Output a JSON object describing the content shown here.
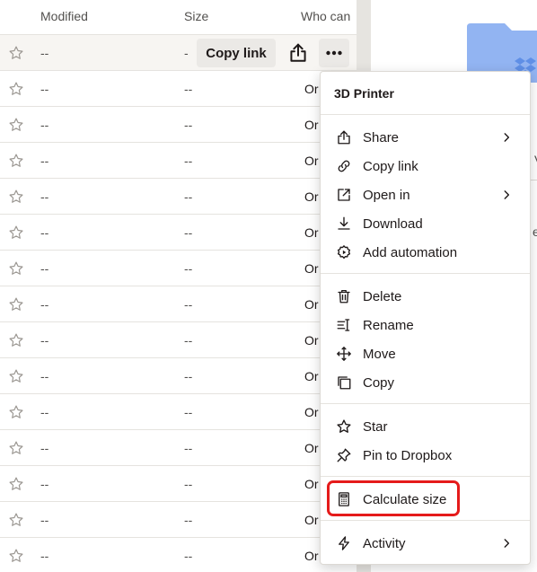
{
  "header": {
    "modified": "Modified",
    "size": "Size",
    "who_can": "Who can"
  },
  "rows": [
    {
      "modified": "--",
      "size": "-",
      "who": "",
      "selected": true
    },
    {
      "modified": "--",
      "size": "--",
      "who": "Or"
    },
    {
      "modified": "--",
      "size": "--",
      "who": "Or"
    },
    {
      "modified": "--",
      "size": "--",
      "who": "Or"
    },
    {
      "modified": "--",
      "size": "--",
      "who": "Or"
    },
    {
      "modified": "--",
      "size": "--",
      "who": "Or"
    },
    {
      "modified": "--",
      "size": "--",
      "who": "Or"
    },
    {
      "modified": "--",
      "size": "--",
      "who": "Or"
    },
    {
      "modified": "--",
      "size": "--",
      "who": "Or"
    },
    {
      "modified": "--",
      "size": "--",
      "who": "Or"
    },
    {
      "modified": "--",
      "size": "--",
      "who": "Or"
    },
    {
      "modified": "--",
      "size": "--",
      "who": "Or"
    },
    {
      "modified": "--",
      "size": "--",
      "who": "Or"
    },
    {
      "modified": "--",
      "size": "--",
      "who": "Or"
    },
    {
      "modified": "--",
      "size": "--",
      "who": "Or"
    }
  ],
  "row_actions": {
    "copy_link": "Copy link"
  },
  "preview": {
    "partial_v": "V",
    "partial_e": "e"
  },
  "menu": {
    "title": "3D Printer",
    "items": [
      {
        "label": "Share",
        "icon": "share-icon",
        "submenu": true
      },
      {
        "label": "Copy link",
        "icon": "link-icon",
        "submenu": false
      },
      {
        "label": "Open in",
        "icon": "open-in-icon",
        "submenu": true
      },
      {
        "label": "Download",
        "icon": "download-icon",
        "submenu": false
      },
      {
        "label": "Add automation",
        "icon": "automation-gear-icon",
        "submenu": false
      },
      {
        "label": "Delete",
        "icon": "trash-icon",
        "submenu": false
      },
      {
        "label": "Rename",
        "icon": "rename-icon",
        "submenu": false
      },
      {
        "label": "Move",
        "icon": "move-icon",
        "submenu": false
      },
      {
        "label": "Copy",
        "icon": "copy-icon",
        "submenu": false
      },
      {
        "label": "Star",
        "icon": "star-icon",
        "submenu": false
      },
      {
        "label": "Pin to Dropbox",
        "icon": "pin-icon",
        "submenu": false
      },
      {
        "label": "Calculate size",
        "icon": "calculator-icon",
        "submenu": false
      },
      {
        "label": "Activity",
        "icon": "activity-icon",
        "submenu": true
      }
    ]
  },
  "colors": {
    "highlight": "#e51b1b",
    "folder": "#92b4f2",
    "dropbox_logo": "#0061fe"
  }
}
